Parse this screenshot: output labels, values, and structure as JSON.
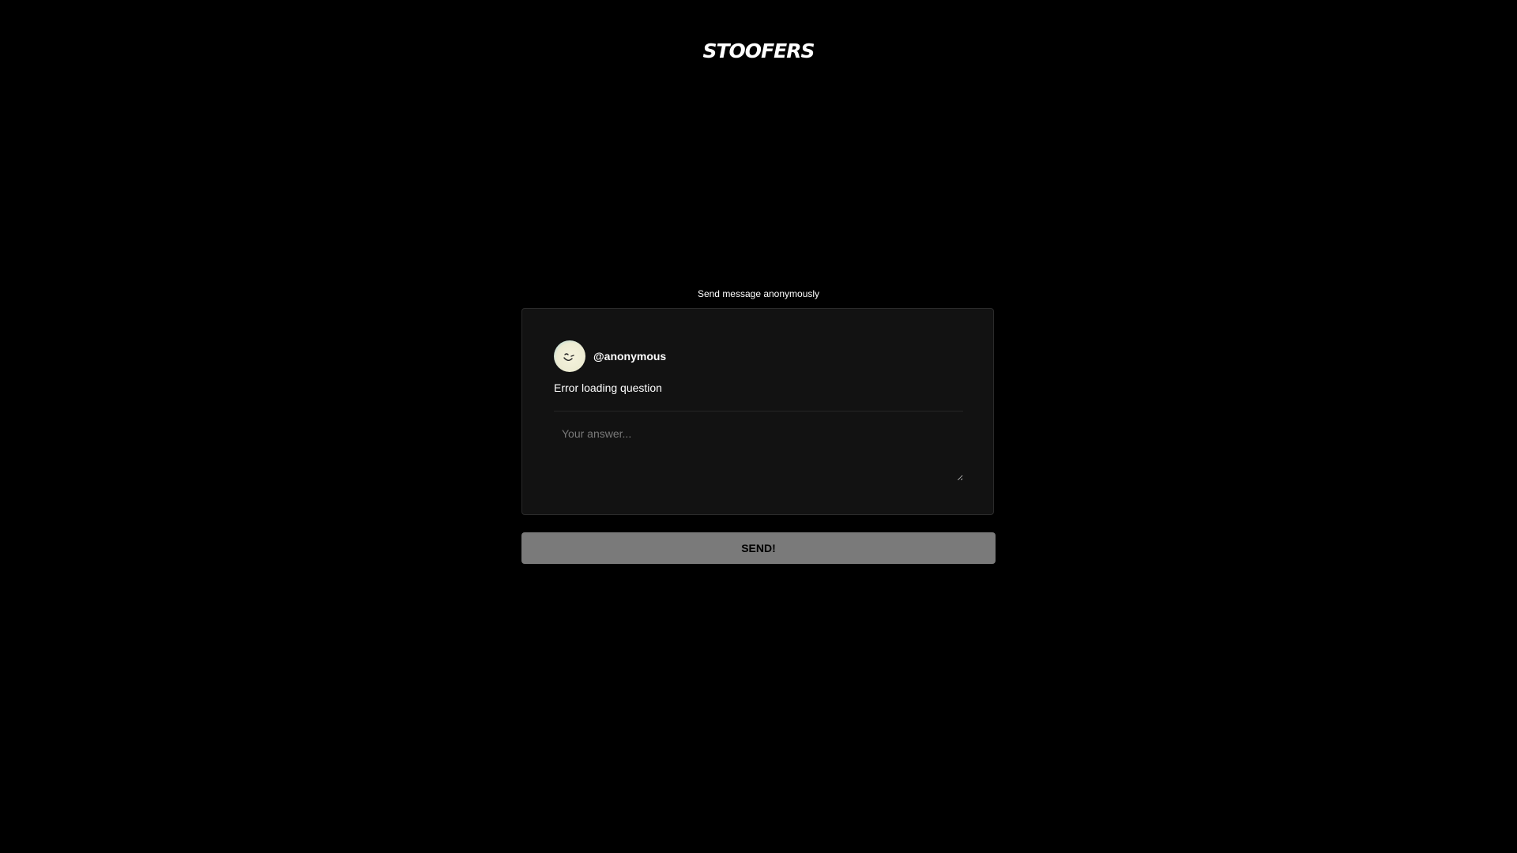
{
  "brand": {
    "logo_text": "STOOFERS"
  },
  "header": {
    "subtitle": "Send message anonymously"
  },
  "card": {
    "avatar_icon": "smiling-moon-avatar",
    "username": "@anonymous",
    "question": "Error loading question",
    "answer": {
      "value": "",
      "placeholder": "Your answer..."
    }
  },
  "actions": {
    "send_label": "SEND!"
  },
  "colors": {
    "background": "#000000",
    "card_background": "#121212",
    "button_background": "#7a7a7a",
    "avatar_accent": "#8fd0de"
  }
}
